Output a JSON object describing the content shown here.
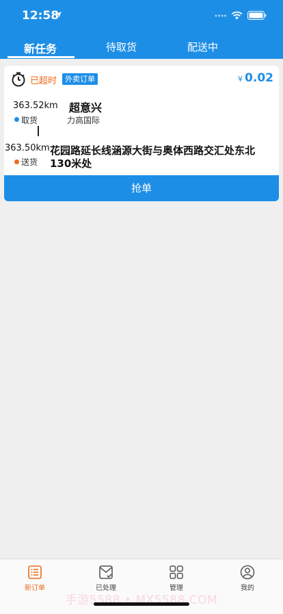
{
  "status_bar": {
    "time": "12:58"
  },
  "tabs": [
    {
      "label": "新任务"
    },
    {
      "label": "待取货"
    },
    {
      "label": "配送中"
    }
  ],
  "order": {
    "status": "已超时",
    "type_badge": "外卖订单",
    "price_symbol": "¥",
    "price": "0.02",
    "pickup": {
      "distance": "363.52km",
      "label": "取货",
      "name": "超意兴",
      "sub": "力高国际"
    },
    "delivery": {
      "distance": "363.50km",
      "label": "送货",
      "address": "花园路延长线涵源大街与奥体西路交汇处东北130米处"
    },
    "grab_label": "抢单"
  },
  "tabbar": [
    {
      "label": "新订单",
      "icon": "list-icon"
    },
    {
      "label": "已处理",
      "icon": "envelope-check-icon"
    },
    {
      "label": "管理",
      "icon": "grid-icon"
    },
    {
      "label": "我的",
      "icon": "user-icon"
    }
  ],
  "watermark": "手游5588 • MX5588.COM",
  "colors": {
    "primary": "#1d8ee6",
    "accent": "#f06a1c",
    "background": "#efefef"
  }
}
